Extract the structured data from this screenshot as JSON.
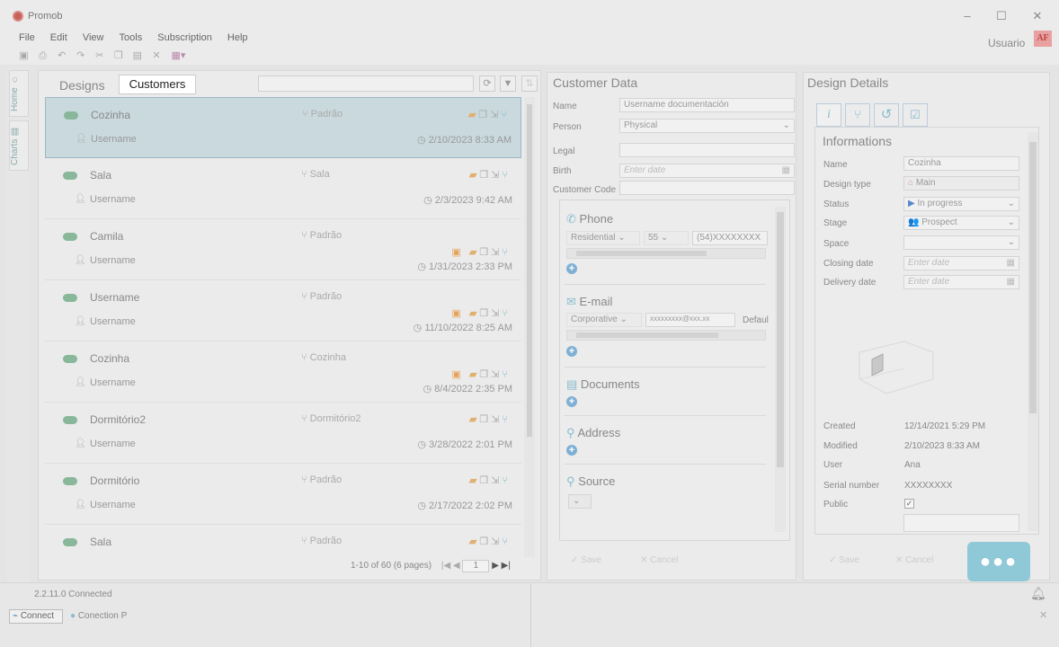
{
  "window": {
    "title": "Promob"
  },
  "menu": [
    "File",
    "Edit",
    "View",
    "Tools",
    "Subscription",
    "Help"
  ],
  "header": {
    "user": "Usuario",
    "avatar": "AF"
  },
  "rail": {
    "home": "Home",
    "charts": "Charts"
  },
  "designs": {
    "tab_designs": "Designs",
    "tab_customers": "Customers",
    "rows": [
      {
        "name": "Cozinha",
        "env": "Padrão",
        "user": "Username",
        "date": "2/10/2023 8:33 AM",
        "selected": true,
        "badge": false
      },
      {
        "name": "Sala",
        "env": "Sala",
        "user": "Username",
        "date": "2/3/2023 9:42 AM",
        "selected": false,
        "badge": false
      },
      {
        "name": "Camila",
        "env": "Padrão",
        "user": "Username",
        "date": "1/31/2023 2:33 PM",
        "selected": false,
        "badge": true
      },
      {
        "name": "Username",
        "env": "Padrão",
        "user": "Username",
        "date": "11/10/2022 8:25 AM",
        "selected": false,
        "badge": true
      },
      {
        "name": "Cozinha",
        "env": "Cozinha",
        "user": "Username",
        "date": "8/4/2022 2:35 PM",
        "selected": false,
        "badge": true
      },
      {
        "name": "Dormitório2",
        "env": "Dormitório2",
        "user": "Username",
        "date": "3/28/2022 2:01 PM",
        "selected": false,
        "badge": false
      },
      {
        "name": "Dormitório",
        "env": "Padrão",
        "user": "Username",
        "date": "2/17/2022 2:02 PM",
        "selected": false,
        "badge": false
      },
      {
        "name": "Sala",
        "env": "Padrão",
        "user": "",
        "date": "",
        "selected": false,
        "badge": false
      }
    ],
    "pager": "1-10 of 60 (6 pages)",
    "page": "1"
  },
  "customer": {
    "title": "Customer Data",
    "name_label": "Name",
    "name_value": "Username documentación",
    "person_label": "Person",
    "person_value": "Physical",
    "legal_label": "Legal",
    "birth_label": "Birth",
    "birth_placeholder": "Enter date",
    "code_label": "Customer Code",
    "phone_title": "Phone",
    "phone_type": "Residential",
    "phone_cc": "55",
    "phone_num": "(54)XXXXXXXX",
    "email_title": "E-mail",
    "email_type": "Corporative",
    "email_value": "xxxxxxxxx@xxx.xx",
    "email_default": "Defaul",
    "documents_title": "Documents",
    "address_title": "Address",
    "source_title": "Source",
    "save": "Save",
    "cancel": "Cancel"
  },
  "details": {
    "title": "Design Details",
    "informations": "Informations",
    "name_label": "Name",
    "name_value": "Cozinha",
    "type_label": "Design type",
    "type_value": "Main",
    "status_label": "Status",
    "status_value": "In progress",
    "stage_label": "Stage",
    "stage_value": "Prospect",
    "space_label": "Space",
    "closing_label": "Closing date",
    "closing_placeholder": "Enter date",
    "delivery_label": "Delivery date",
    "delivery_placeholder": "Enter date",
    "created_label": "Created",
    "created_value": "12/14/2021 5:29 PM",
    "modified_label": "Modified",
    "modified_value": "2/10/2023 8:33 AM",
    "user_label": "User",
    "user_value": "Ana",
    "serial_label": "Serial number",
    "serial_value": "XXXXXXXX",
    "public_label": "Public",
    "save": "Save",
    "cancel": "Cancel"
  },
  "status": {
    "version": "2.2.11.0 Connected",
    "connect": "Connect",
    "connection": "Conection P"
  },
  "colors": {
    "accent": "#8fc8d6",
    "selection": "#c9d9de"
  }
}
